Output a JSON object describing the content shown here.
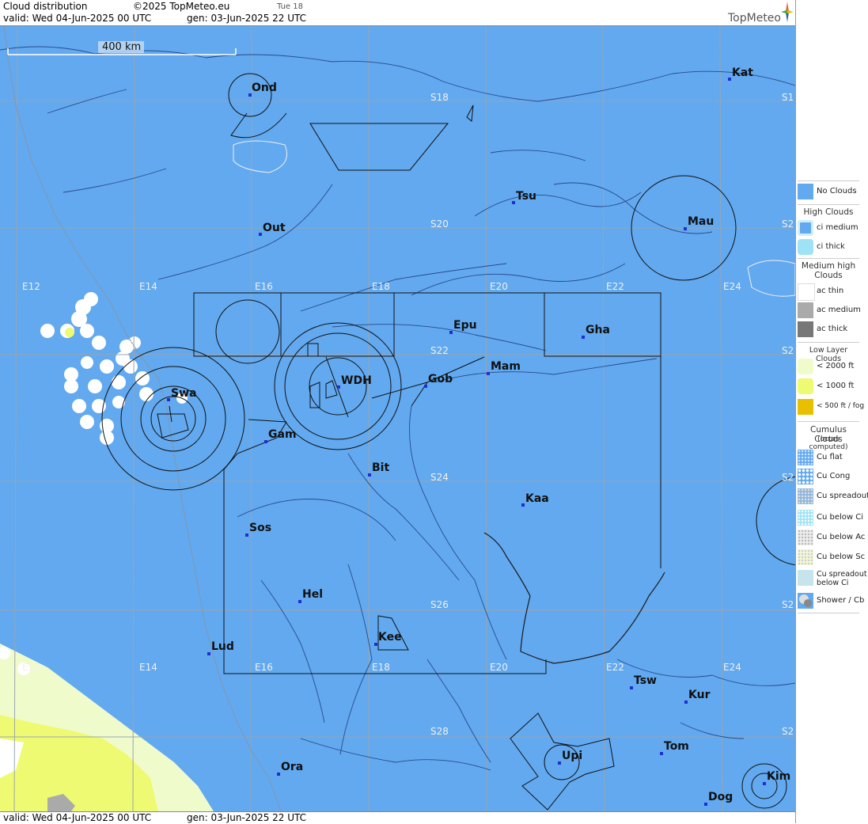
{
  "header": {
    "product": "Cloud distribution",
    "copyright": "©2025 TopMeteo.eu",
    "day_hour": "Tue 18",
    "valid": "valid:  Wed  04-Jun-2025  00 UTC",
    "generated": "gen: 03-Jun-2025 22 UTC",
    "logo": "TopMeteo"
  },
  "footer": {
    "valid": "valid:  Wed  04-Jun-2025  00 UTC",
    "generated": "gen: 03-Jun-2025 22 UTC"
  },
  "scale": {
    "label": "400 km"
  },
  "colors": {
    "sea": "#62a9ef",
    "no_clouds": "#62a9ef",
    "low_2000": "#f0fbcc",
    "low_1000": "#eefa72",
    "low_500": "#e8c000",
    "ac_medium": "#aaaaaa",
    "ac_thick": "#777777"
  },
  "legend": {
    "no_clouds": "No Clouds",
    "high_title": "High Clouds",
    "ci_medium": "ci medium",
    "ci_thick": "ci thick",
    "medium_title_1": "Medium high",
    "medium_title_2": "Clouds",
    "ac_thin": "ac thin",
    "ac_medium": "ac medium",
    "ac_thick": "ac thick",
    "low_title": "Low Layer Clouds",
    "low_2000": "< 2000 ft",
    "low_1000": "< 1000 ft",
    "low_500": "< 500 ft / fog",
    "cu_title_1": "Cumulus Clouds",
    "cu_title_2": "(octas computed)",
    "cu_flat": "Cu flat",
    "cu_cong": "Cu Cong",
    "cu_spreadout": "Cu spreadout",
    "cu_below_ci": "Cu below Ci",
    "cu_below_ac": "Cu below Ac",
    "cu_below_sc": "Cu below Sc",
    "cu_spreadout_below_ci_1": "Cu spreadout",
    "cu_spreadout_below_ci_2": "below Ci",
    "shower": "Shower / Cb"
  },
  "cities": [
    {
      "name": "Ond"
    },
    {
      "name": "Kat"
    },
    {
      "name": "Tsu"
    },
    {
      "name": "Mau"
    },
    {
      "name": "Out"
    },
    {
      "name": "Epu"
    },
    {
      "name": "Gha"
    },
    {
      "name": "Mam"
    },
    {
      "name": "Swa"
    },
    {
      "name": "WDH"
    },
    {
      "name": "Gob"
    },
    {
      "name": "Gam"
    },
    {
      "name": "Bit"
    },
    {
      "name": "Kaa"
    },
    {
      "name": "Sos"
    },
    {
      "name": "Hel"
    },
    {
      "name": "Kee"
    },
    {
      "name": "Lud"
    },
    {
      "name": "Tsw"
    },
    {
      "name": "Kur"
    },
    {
      "name": "Tom"
    },
    {
      "name": "Upi"
    },
    {
      "name": "Ora"
    },
    {
      "name": "Kim"
    },
    {
      "name": "Dog"
    }
  ],
  "grid_labels": {
    "lat": [
      "S18",
      "S20",
      "S22",
      "S24",
      "S26",
      "S28"
    ],
    "lon": [
      "E12",
      "E14",
      "E16",
      "E18",
      "E20",
      "E22",
      "E24"
    ],
    "edge_lat": [
      "S1",
      "S2",
      "S2",
      "S2",
      "S2",
      "S2"
    ]
  }
}
